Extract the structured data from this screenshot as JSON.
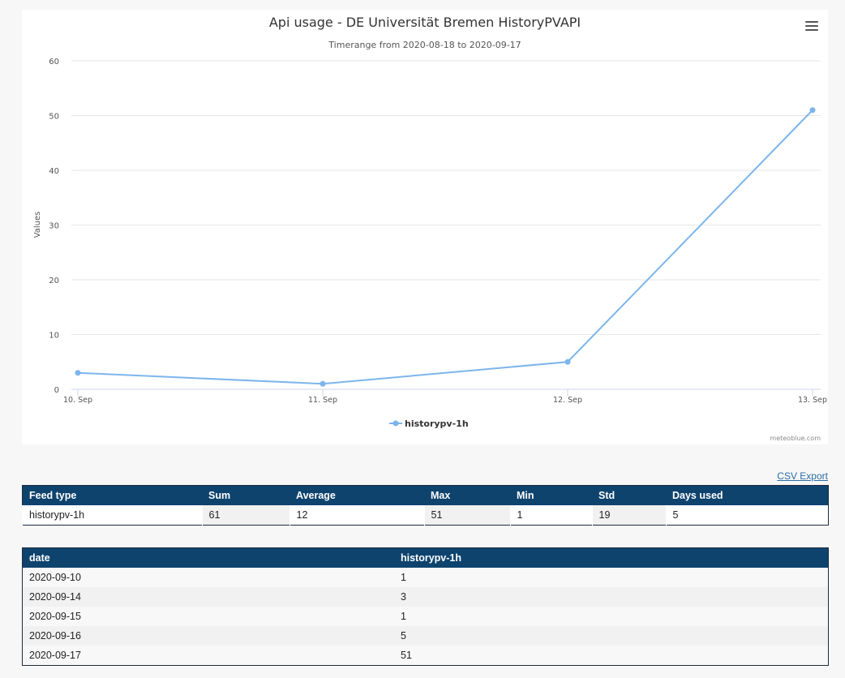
{
  "chart_data": {
    "type": "line",
    "title": "Api usage - DE Universität Bremen HistoryPVAPI",
    "subtitle": "Timerange from 2020-08-18 to 2020-09-17",
    "ylabel": "Values",
    "xlabel": "",
    "ylim": [
      0,
      60
    ],
    "yticks": [
      "0",
      "10",
      "20",
      "30",
      "40",
      "50",
      "60"
    ],
    "categories": [
      "10. Sep",
      "11. Sep",
      "12. Sep",
      "13. Sep"
    ],
    "series": [
      {
        "name": "historypv-1h",
        "values": [
          3,
          1,
          5,
          51
        ],
        "color": "#7cb5ec"
      }
    ],
    "grid": true,
    "legend": "bottom-center",
    "credit": "meteoblue.com"
  },
  "menu_icon": "hamburger-menu-icon",
  "csv_export_label": "CSV Export",
  "stats_table": {
    "headers": [
      "Feed type",
      "Sum",
      "Average",
      "Max",
      "Min",
      "Std",
      "Days used"
    ],
    "rows": [
      [
        "historypv-1h",
        "61",
        "12",
        "51",
        "1",
        "19",
        "5"
      ]
    ]
  },
  "daily_table": {
    "headers": [
      "date",
      "historypv-1h"
    ],
    "rows": [
      [
        "2020-09-10",
        "1"
      ],
      [
        "2020-09-14",
        "3"
      ],
      [
        "2020-09-15",
        "1"
      ],
      [
        "2020-09-16",
        "5"
      ],
      [
        "2020-09-17",
        "51"
      ]
    ]
  },
  "colors": {
    "header_bg": "#0e436e",
    "series": "#7cb5ec",
    "link": "#2b6ea6"
  }
}
